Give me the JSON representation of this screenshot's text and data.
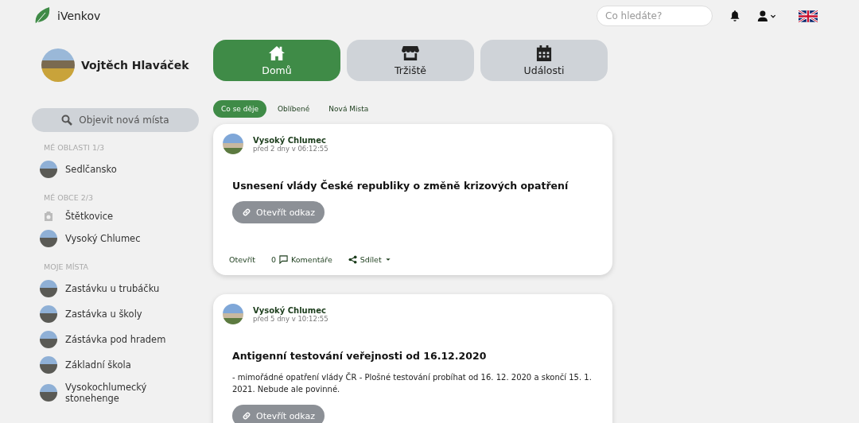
{
  "header": {
    "brand": "iVenkov",
    "search": {
      "placeholder": "Co hledáte?"
    }
  },
  "profile": {
    "name": "Vojtěch Hlaváček"
  },
  "discover_button": "Objevit nová místa",
  "sidebar": {
    "sections": [
      {
        "heading": "MÉ OBLASTI 1/3",
        "items": [
          {
            "label": "Sedlčansko",
            "kind": "photo"
          }
        ]
      },
      {
        "heading": "MÉ OBCE 2/3",
        "items": [
          {
            "label": "Štětkovice",
            "kind": "no-photo"
          },
          {
            "label": "Vysoký Chlumec",
            "kind": "photo"
          }
        ]
      },
      {
        "heading": "MOJE MÍSTA",
        "items": [
          {
            "label": "Zastávku u trubáčku",
            "kind": "photo"
          },
          {
            "label": "Zastávka u školy",
            "kind": "photo"
          },
          {
            "label": "Zástávka pod hradem",
            "kind": "photo"
          },
          {
            "label": "Základní škola",
            "kind": "photo"
          },
          {
            "label": "Vysokochlumecký stonehenge",
            "kind": "photo"
          }
        ]
      }
    ]
  },
  "nav_tabs": [
    {
      "label": "Domů",
      "kind": "home",
      "selected": true
    },
    {
      "label": "Tržiště",
      "kind": "store",
      "selected": false
    },
    {
      "label": "Události",
      "kind": "calendar",
      "selected": false
    }
  ],
  "feed_tabs": [
    {
      "label": "Co se děje",
      "selected": true
    },
    {
      "label": "Oblíbené",
      "selected": false
    },
    {
      "label": "Nová Mista",
      "selected": false
    }
  ],
  "posts": [
    {
      "place": "Vysoký Chlumec",
      "time": "před 2 dny v 06:12:55",
      "title": "Usnesení vlády České republiky o změně krizových opatření",
      "link": "Otevřít odkaz",
      "actions": {
        "open": "Otevřít",
        "comment_count": "0",
        "comments": "Komentáře",
        "share": "Sdílet"
      }
    },
    {
      "place": "Vysoký Chlumec",
      "time": "před 5 dny v 10:12:55",
      "title": "Antigenní testování veřejnosti od 16.12.2020",
      "body": "- mimořádné opatření vlády ČR - Plošné testování probíhat od 16. 12. 2020 a skončí 15. 1. 2021. Nebude ale povinné.",
      "link": "Otevřít odkaz"
    }
  ]
}
